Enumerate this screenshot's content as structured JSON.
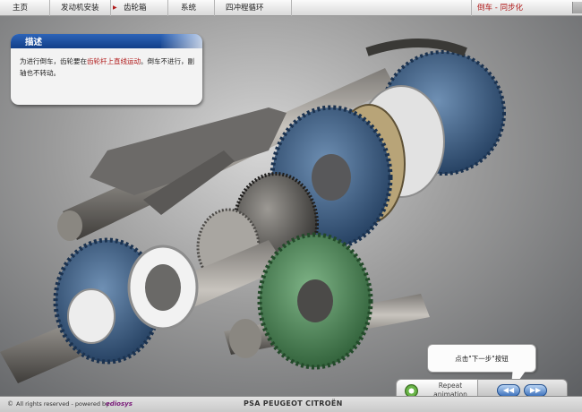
{
  "nav": {
    "items": [
      {
        "label": "主页"
      },
      {
        "label": "发动机安装"
      },
      {
        "label": "齿轮箱"
      },
      {
        "label": "系统"
      },
      {
        "label": "四冲程循环"
      }
    ],
    "current": "倒车 - 同步化"
  },
  "panel": {
    "title": "描述",
    "text_before": "为进行倒车，齿轮要在",
    "highlight": "齿轮杆上直线运动",
    "text_after": "。倒车不进行，副轴也不转动。"
  },
  "bubble": {
    "text": "点击\"下一步\"按钮"
  },
  "controls": {
    "repeat_label": "Repeat\nanimation",
    "prev_symbol": "◀◀",
    "next_symbol": "▶▶"
  },
  "footer": {
    "copyright": "All rights reserved  -  powered by",
    "brand": "ediosys",
    "company": "PSA PEUGEOT CITROËN"
  },
  "colors": {
    "accent_red": "#b01818",
    "header_blue": "#123f88",
    "gear_blue": "#3d5f86",
    "gear_green": "#4f8a5a"
  }
}
